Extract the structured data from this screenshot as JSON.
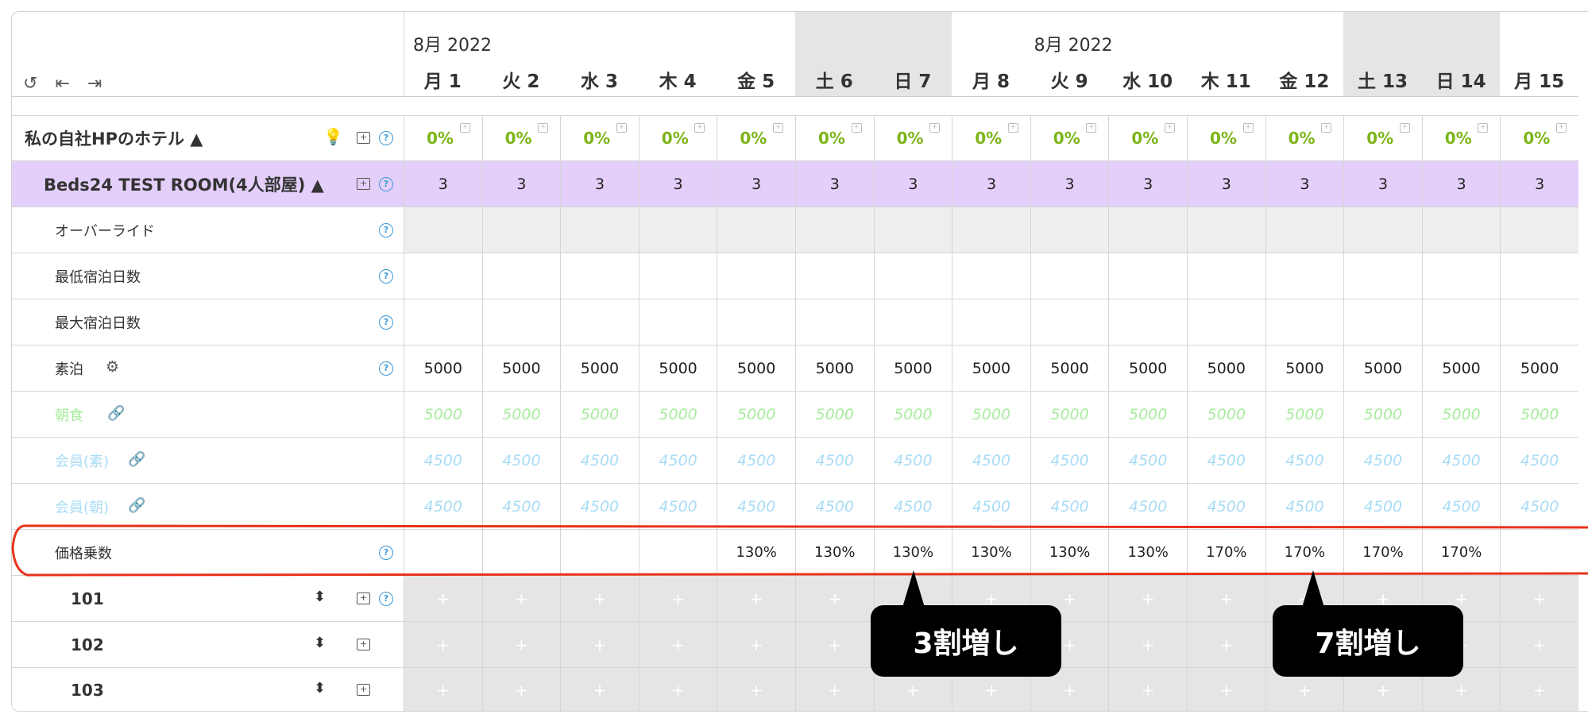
{
  "toolbar": {
    "undo_icon": "↺",
    "first_icon": "⇤",
    "last_icon": "⇥"
  },
  "months": [
    "8月 2022",
    "8月 2022"
  ],
  "days": [
    "月 1",
    "火 2",
    "水 3",
    "木 4",
    "金 5",
    "土 6",
    "日 7",
    "月 8",
    "火 9",
    "水 10",
    "木 11",
    "金 12",
    "土 13",
    "日 14",
    "月 15"
  ],
  "property": {
    "name": "私の自社HPのホテル ▲",
    "occupancy": [
      "0%",
      "0%",
      "0%",
      "0%",
      "0%",
      "0%",
      "0%",
      "0%",
      "0%",
      "0%",
      "0%",
      "0%",
      "0%",
      "0%",
      "0%"
    ]
  },
  "room": {
    "name": "Beds24 TEST ROOM(4人部屋) ▲",
    "available": [
      "3",
      "3",
      "3",
      "3",
      "3",
      "3",
      "3",
      "3",
      "3",
      "3",
      "3",
      "3",
      "3",
      "3",
      "3"
    ]
  },
  "rows": {
    "override": "オーバーライド",
    "min_stay": "最低宿泊日数",
    "max_stay": "最大宿泊日数",
    "room_only": {
      "label": "素泊",
      "values": [
        "5000",
        "5000",
        "5000",
        "5000",
        "5000",
        "5000",
        "5000",
        "5000",
        "5000",
        "5000",
        "5000",
        "5000",
        "5000",
        "5000",
        "5000"
      ]
    },
    "breakfast": {
      "label": "朝食",
      "values": [
        "5000",
        "5000",
        "5000",
        "5000",
        "5000",
        "5000",
        "5000",
        "5000",
        "5000",
        "5000",
        "5000",
        "5000",
        "5000",
        "5000",
        "5000"
      ]
    },
    "member_plain": {
      "label": "会員(素)",
      "values": [
        "4500",
        "4500",
        "4500",
        "4500",
        "4500",
        "4500",
        "4500",
        "4500",
        "4500",
        "4500",
        "4500",
        "4500",
        "4500",
        "4500",
        "4500"
      ]
    },
    "member_breakfast": {
      "label": "会員(朝)",
      "values": [
        "4500",
        "4500",
        "4500",
        "4500",
        "4500",
        "4500",
        "4500",
        "4500",
        "4500",
        "4500",
        "4500",
        "4500",
        "4500",
        "4500",
        "4500"
      ]
    },
    "multiplier": {
      "label": "価格乗数",
      "values": [
        "",
        "",
        "",
        "",
        "130%",
        "130%",
        "130%",
        "130%",
        "130%",
        "130%",
        "170%",
        "170%",
        "170%",
        "170%",
        ""
      ]
    }
  },
  "units": [
    "101",
    "102",
    "103"
  ],
  "callouts": {
    "left": "3割増し",
    "right": "7割増し"
  },
  "colors": {
    "room_row_bg": "#e3cffa",
    "weekend_bg": "#e5e5e5",
    "occupancy_green": "#7cb518",
    "breakfast_green": "#a8ec9e",
    "member_blue": "#a9dcf6",
    "highlight_red": "#e8321c"
  }
}
